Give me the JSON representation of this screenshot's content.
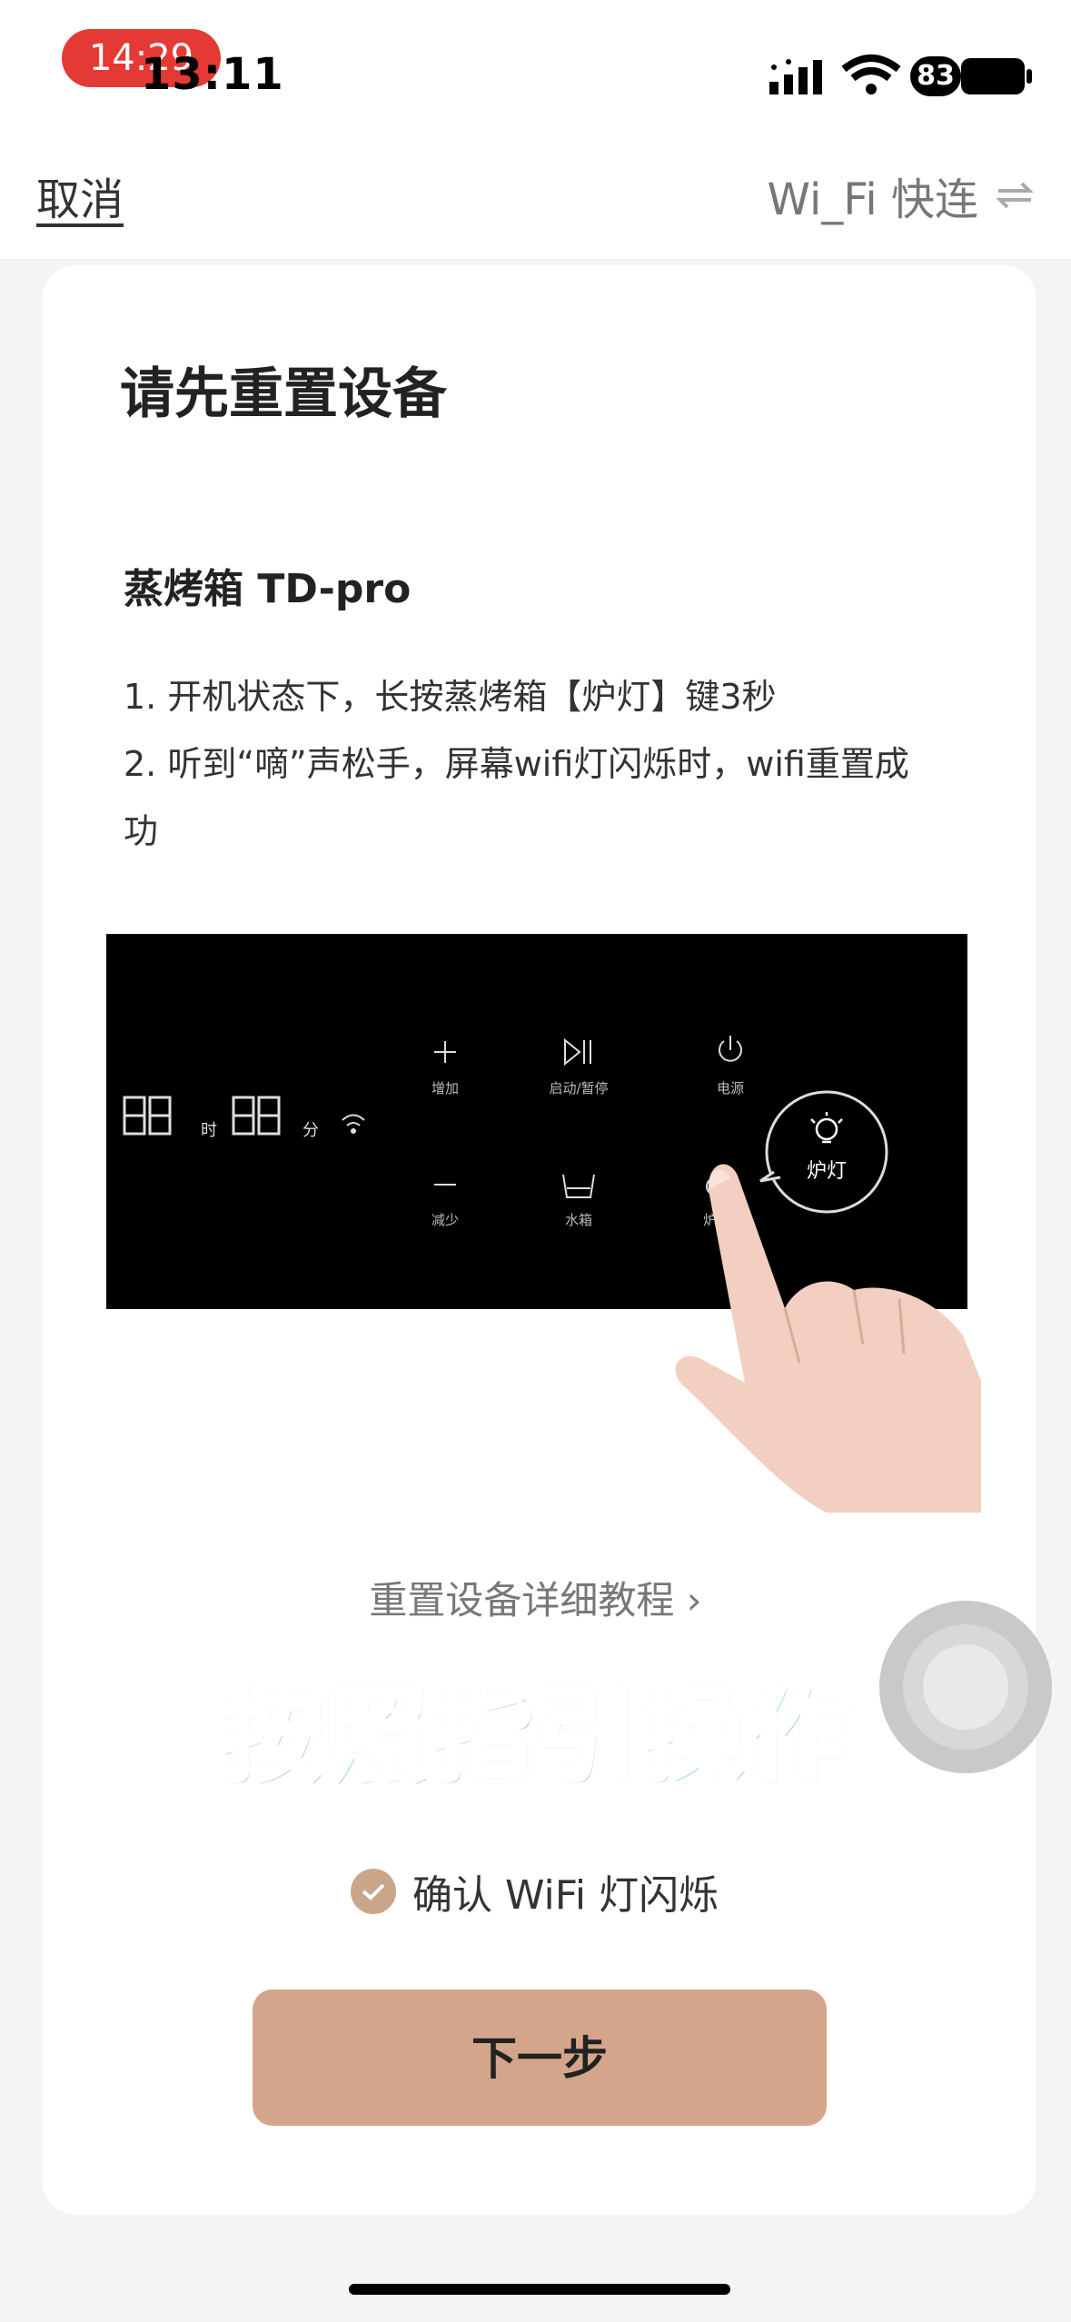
{
  "status_bar": {
    "recording_time": "14:29",
    "clock": "13:11",
    "battery_level": "83"
  },
  "nav": {
    "cancel_label": "取消",
    "wifi_quick_label": "Wi_Fi 快连",
    "switch_icon": "swap-arrows-icon"
  },
  "card": {
    "title": "请先重置设备",
    "device_name": "蒸烤箱 TD-pro",
    "steps": [
      "1. 开机状态下，长按蒸烤箱【炉灯】键3秒",
      "2. 听到“嘀”声松手，屏幕wifi灯闪烁时，wifi重置成功"
    ]
  },
  "panel": {
    "digits_left": "88",
    "label_hour": "时",
    "digits_right": "88",
    "label_minute": "分",
    "buttons": [
      {
        "icon": "plus-icon",
        "label": "增加"
      },
      {
        "icon": "play-pause-icon",
        "label": "启动/暂停"
      },
      {
        "icon": "power-icon",
        "label": "电源"
      },
      {
        "icon": "minus-icon",
        "label": "减少"
      },
      {
        "icon": "water-tank-icon",
        "label": "水箱"
      },
      {
        "icon": "lamp-icon",
        "label": "炉灯"
      }
    ],
    "callout_label": "炉灯"
  },
  "tutorial_link": "重置设备详细教程 ›",
  "guide_banner": "按照指引操作",
  "confirm": {
    "checked": true,
    "label": "确认 WiFi 灯闪烁"
  },
  "next_button": "下一步",
  "colors": {
    "accent": "#d4a58a",
    "check": "#c9a58a",
    "banner": "#5aa8f2",
    "rec": "#e53935"
  }
}
